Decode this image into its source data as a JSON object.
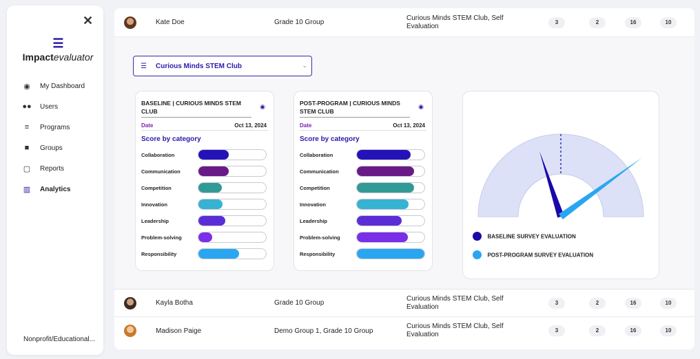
{
  "app": {
    "brand_top": "Impact",
    "brand_bottom": "evaluator"
  },
  "sidebar": {
    "items": [
      {
        "label": "My Dashboard",
        "icon": "user-circle-icon"
      },
      {
        "label": "Users",
        "icon": "users-icon"
      },
      {
        "label": "Programs",
        "icon": "list-icon"
      },
      {
        "label": "Groups",
        "icon": "groups-icon"
      },
      {
        "label": "Reports",
        "icon": "pdf-file-icon"
      },
      {
        "label": "Analytics",
        "icon": "bar-chart-icon"
      }
    ],
    "footer": "Nonprofit/Educational..."
  },
  "rows": [
    {
      "name": "Kate Doe",
      "group": "Grade 10 Group",
      "program": "Curious Minds STEM Club, Self Evaluation",
      "counts": [
        "3",
        "2",
        "16",
        "10"
      ]
    },
    {
      "name": "Kayla Botha",
      "group": "Grade 10 Group",
      "program": "Curious Minds STEM Club, Self Evaluation",
      "counts": [
        "3",
        "2",
        "16",
        "10"
      ]
    },
    {
      "name": "Madison Paige",
      "group": "Demo Group 1, Grade 10 Group",
      "program": "Curious Minds STEM Club, Self Evaluation",
      "counts": [
        "3",
        "2",
        "16",
        "10"
      ]
    }
  ],
  "detail": {
    "select_value": "Curious Minds STEM Club",
    "cards": [
      {
        "title": "BASELINE | CURIOUS MINDS STEM CLUB",
        "date_label": "Date",
        "date_value": "Oct 13, 2024",
        "section": "Score by category",
        "scores": [
          {
            "label": "Collaboration",
            "value": 0.45,
            "color": "#2412b8"
          },
          {
            "label": "Communication",
            "value": 0.45,
            "color": "#6a1a86"
          },
          {
            "label": "Competition",
            "value": 0.35,
            "color": "#329a96"
          },
          {
            "label": "Innovation",
            "value": 0.36,
            "color": "#36b2d2"
          },
          {
            "label": "Leadership",
            "value": 0.4,
            "color": "#5a2ed6"
          },
          {
            "label": "Problem-solving",
            "value": 0.2,
            "color": "#7a2ee8"
          },
          {
            "label": "Responsibility",
            "value": 0.6,
            "color": "#2aa6f0"
          }
        ]
      },
      {
        "title": "POST-PROGRAM | CURIOUS MINDS STEM CLUB",
        "date_label": "Date",
        "date_value": "Oct 13, 2024",
        "section": "Score by category",
        "scores": [
          {
            "label": "Collaboration",
            "value": 0.8,
            "color": "#2412b8"
          },
          {
            "label": "Communication",
            "value": 0.85,
            "color": "#6a1a86"
          },
          {
            "label": "Competition",
            "value": 0.85,
            "color": "#329a96"
          },
          {
            "label": "Innovation",
            "value": 0.77,
            "color": "#36b2d2"
          },
          {
            "label": "Leadership",
            "value": 0.66,
            "color": "#5a2ed6"
          },
          {
            "label": "Problem-solving",
            "value": 0.75,
            "color": "#7a2ee8"
          },
          {
            "label": "Responsibility",
            "value": 1.0,
            "color": "#2aa6f0"
          }
        ]
      }
    ],
    "gauge": {
      "baseline_label": "BASELINE SURVEY EVALUATION",
      "post_label": "POST-PROGRAM SURVEY EVALUATION",
      "baseline_color": "#1a0aa8",
      "post_color": "#2aa6f0",
      "baseline_value": 0.4,
      "post_value": 0.8,
      "reference_value": 0.5
    }
  }
}
